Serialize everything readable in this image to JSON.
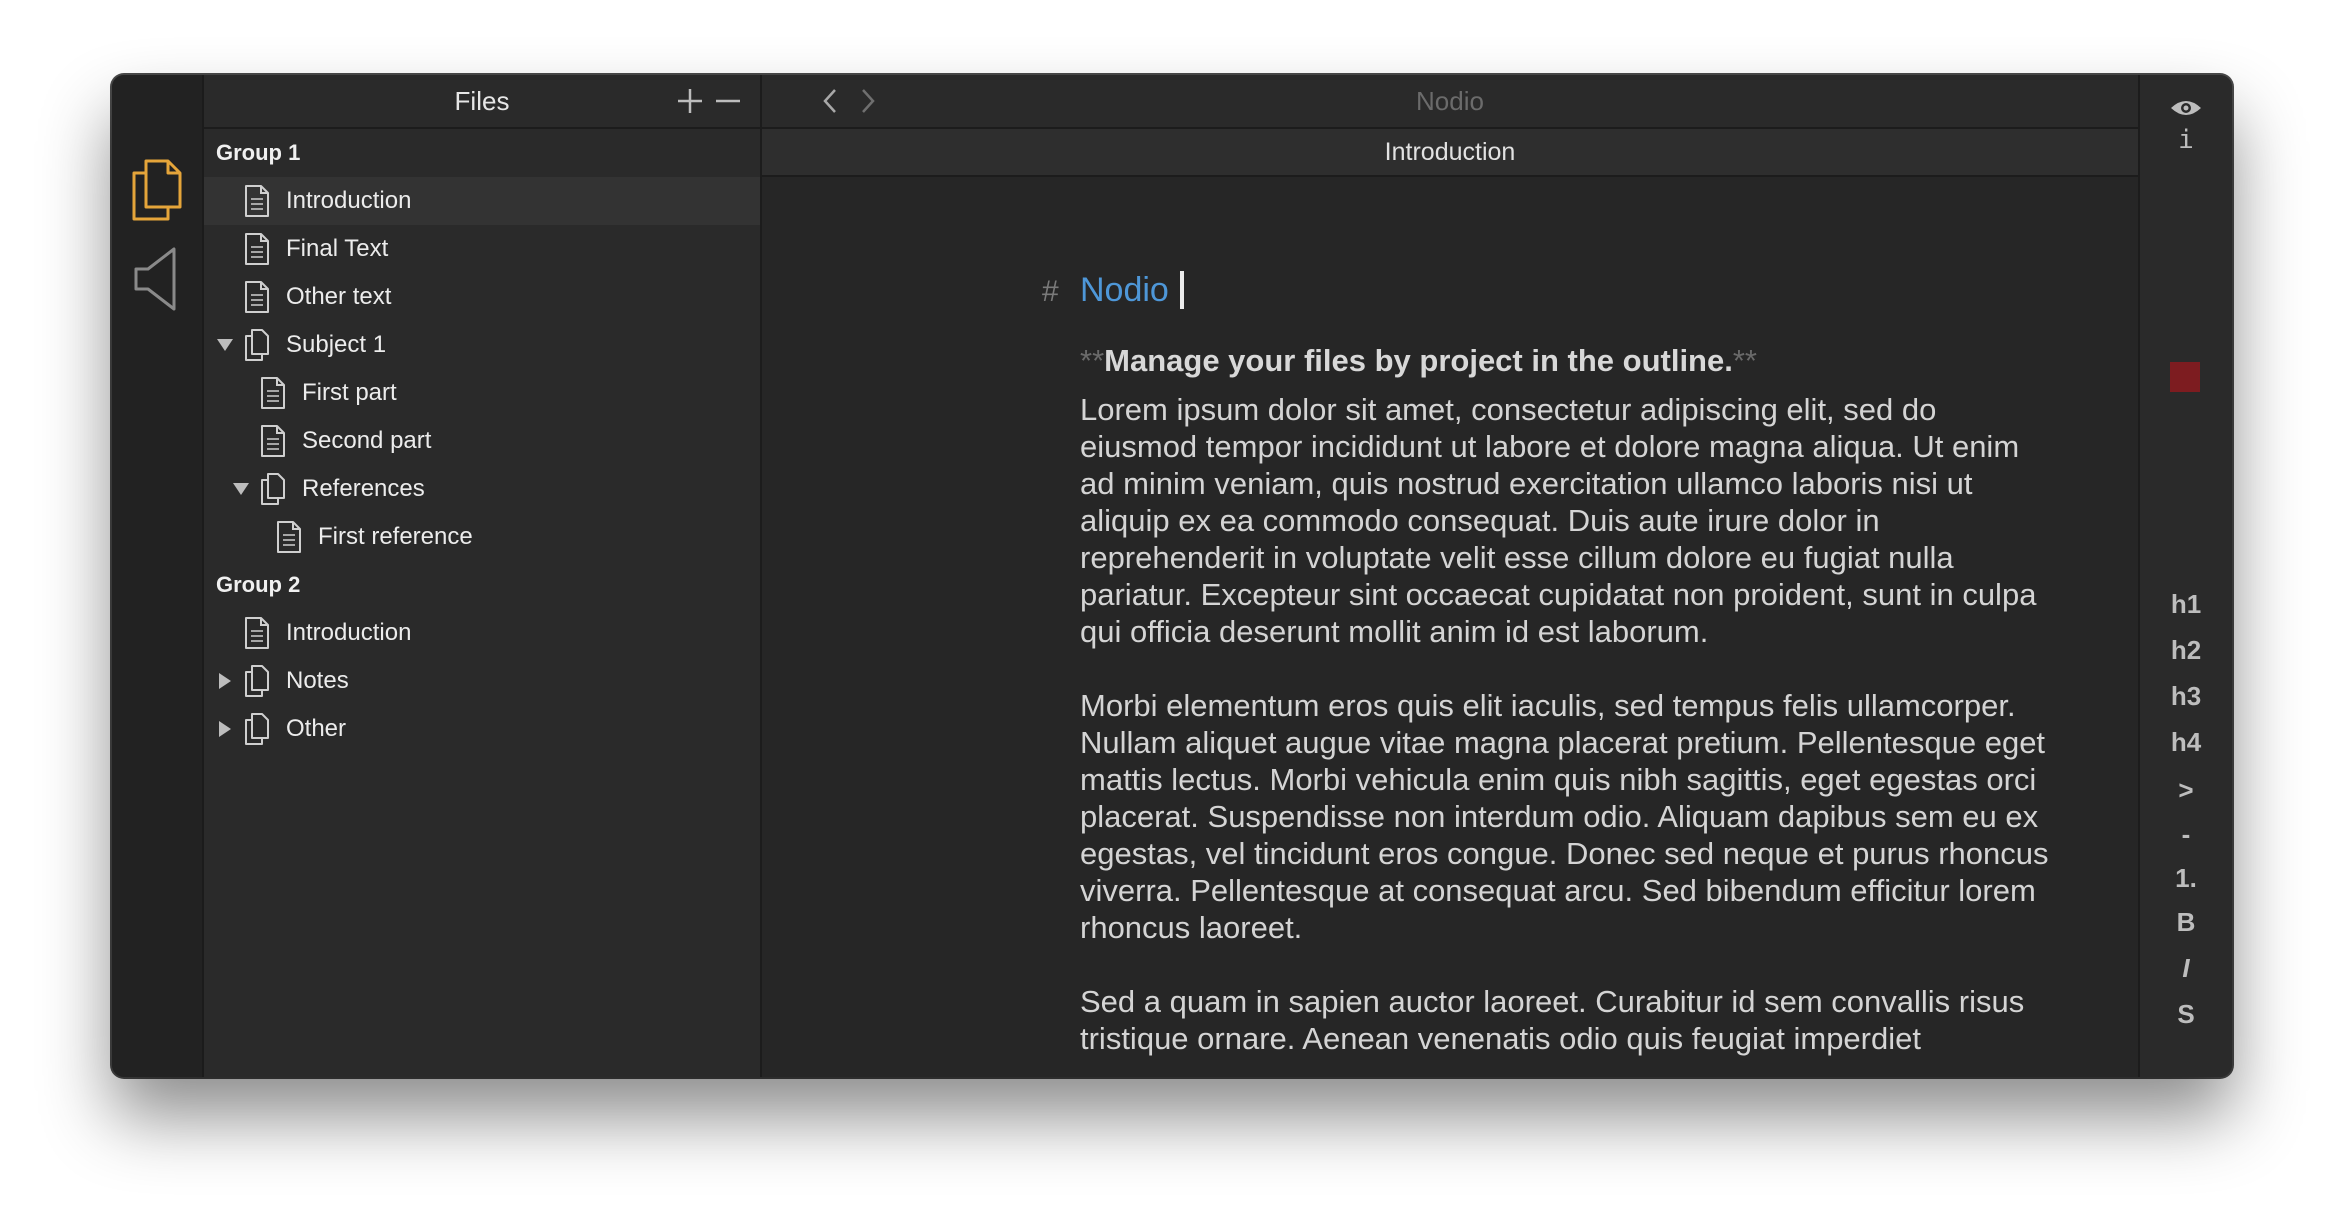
{
  "app": {
    "title": "Nodio"
  },
  "rail": {
    "items": [
      {
        "icon": "files-icon",
        "active": true
      },
      {
        "icon": "speaker-icon",
        "active": false
      }
    ]
  },
  "sidebar": {
    "title": "Files",
    "add_icon": "plus-icon",
    "remove_icon": "minus-icon",
    "tree": [
      {
        "type": "group",
        "label": "Group 1"
      },
      {
        "type": "file",
        "label": "Introduction",
        "level": 1,
        "selected": true
      },
      {
        "type": "file",
        "label": "Final Text",
        "level": 1
      },
      {
        "type": "file",
        "label": "Other text",
        "level": 1
      },
      {
        "type": "folder",
        "label": "Subject 1",
        "level": 1,
        "expanded": true
      },
      {
        "type": "file",
        "label": "First part",
        "level": 2
      },
      {
        "type": "file",
        "label": "Second part",
        "level": 2
      },
      {
        "type": "folder",
        "label": "References",
        "level": 2,
        "expanded": true
      },
      {
        "type": "file",
        "label": "First reference",
        "level": 3
      },
      {
        "type": "group",
        "label": "Group 2"
      },
      {
        "type": "file",
        "label": "Introduction",
        "level": 1
      },
      {
        "type": "folder",
        "label": "Notes",
        "level": 1,
        "expanded": false
      },
      {
        "type": "folder",
        "label": "Other",
        "level": 1,
        "expanded": false
      }
    ]
  },
  "main": {
    "nav": {
      "back_icon": "chevron-left-icon",
      "forward_icon": "chevron-right-icon"
    },
    "document_title": "Introduction",
    "editor": {
      "heading_marker": "#",
      "heading": "Nodio",
      "bold_marker": "**",
      "bold_text": "Manage your files by project in the outline.",
      "paragraphs": [
        "Lorem ipsum dolor sit amet, consectetur adipiscing elit, sed do eiusmod tempor incididunt ut labore et dolore magna aliqua. Ut enim ad minim veniam, quis nostrud exercitation ullamco laboris nisi ut aliquip ex ea commodo consequat. Duis aute irure dolor in reprehenderit in voluptate velit esse cillum dolore eu fugiat nulla pariatur. Excepteur sint occaecat cupidatat non proident, sunt in culpa qui officia deserunt mollit anim id est laborum.",
        "Morbi elementum eros quis elit iaculis, sed tempus felis ullamcorper. Nullam aliquet augue vitae magna placerat pretium. Pellentesque eget mattis lectus. Morbi vehicula enim quis nibh sagittis, eget egestas orci placerat. Suspendisse non interdum odio. Aliquam dapibus sem eu ex egestas, vel tincidunt eros congue. Donec sed neque et purus rhoncus viverra. Pellentesque at consequat arcu. Sed bibendum efficitur lorem rhoncus laoreet.",
        "Sed a quam in sapien auctor laoreet. Curabitur id sem convallis risus tristique ornare. Aenean venenatis odio quis feugiat imperdiet"
      ]
    }
  },
  "right_rail": {
    "preview_icon": "eye-icon",
    "info_label": "i",
    "color_swatch": "#7d1c20",
    "format_buttons": [
      "h1",
      "h2",
      "h3",
      "h4",
      ">",
      "-",
      "1.",
      "B",
      "I",
      "S"
    ]
  },
  "colors": {
    "accent": "#e5a53a",
    "heading": "#4e97d8",
    "background": "#262626"
  }
}
